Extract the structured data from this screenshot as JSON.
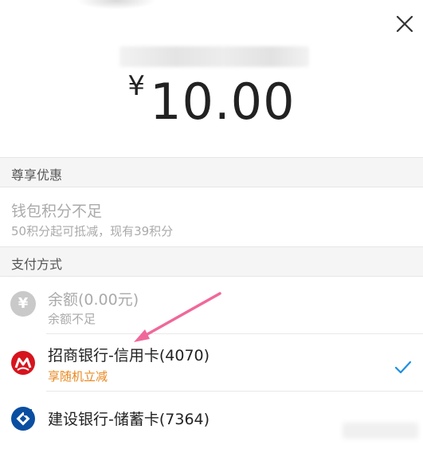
{
  "header": {
    "close_icon": "close-icon"
  },
  "amount": {
    "currency": "¥",
    "value": "10.00"
  },
  "discount_section": {
    "title": "尊享优惠",
    "item_title": "钱包积分不足",
    "item_desc": "50积分起可抵减，现有39积分"
  },
  "payment_section": {
    "title": "支付方式",
    "methods": [
      {
        "name": "余额(0.00元)",
        "sub": "余额不足",
        "icon": "yuan-balance-icon",
        "disabled": true
      },
      {
        "name": "招商银行-信用卡(4070)",
        "sub": "享随机立减",
        "icon": "cmb-bank-icon",
        "selected": true
      },
      {
        "name": "建设银行-储蓄卡(7364)",
        "sub": "",
        "icon": "ccb-bank-icon"
      }
    ]
  },
  "colors": {
    "accent_blue": "#1f8fe0",
    "promo_orange": "#e8871e",
    "cmb_red": "#d6141e",
    "ccb_blue": "#0a4ea1",
    "annotation_pink": "#f0689a"
  }
}
